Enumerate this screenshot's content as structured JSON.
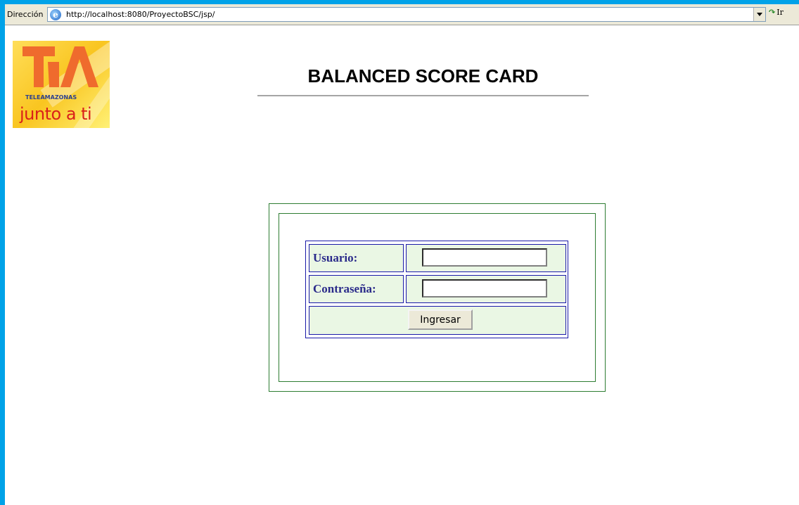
{
  "browser": {
    "address_label": "Dirección",
    "url": "http://localhost:8080/ProyectoBSC/jsp/",
    "go_label": "Ir"
  },
  "logo": {
    "brand_text": "TELEAMAZONAS",
    "tagline": "junto a ti"
  },
  "page": {
    "title": "BALANCED SCORE CARD"
  },
  "login": {
    "username_label": "Usuario:",
    "username_value": "",
    "password_label": "Contraseña:",
    "password_value": "",
    "submit_label": "Ingresar"
  },
  "colors": {
    "frame_blue": "#00a2e8",
    "box_green": "#2e7d32",
    "table_blue": "#1a1aa8",
    "cell_bg": "#eaf7e4",
    "logo_red": "#d9201a"
  }
}
